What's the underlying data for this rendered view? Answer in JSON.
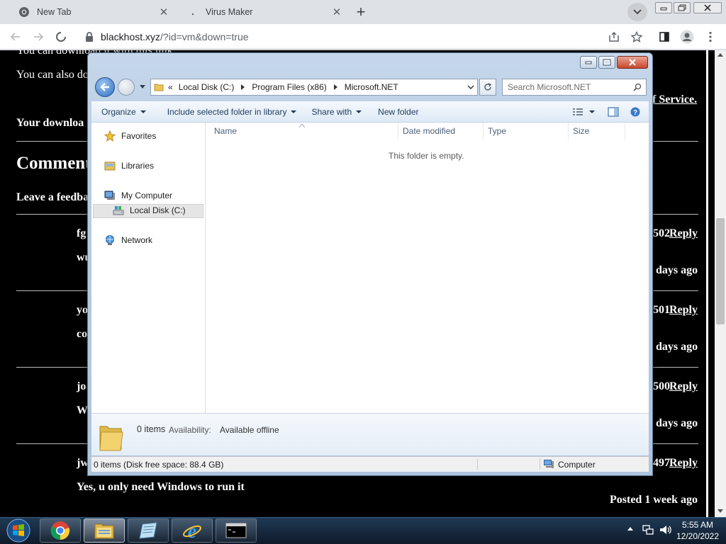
{
  "browser": {
    "tabs": [
      {
        "title": "New Tab"
      },
      {
        "title": "Virus Maker"
      }
    ],
    "url_host": "blackhost.xyz",
    "url_path": "/?id=vm&down=true"
  },
  "page": {
    "line_download": "You can download it with this link",
    "line_also": "You can also do",
    "terms_link": "f Service.",
    "your_download": "Your downloa",
    "comments_heading": "Comment",
    "leave_feedback": "Leave a feedba",
    "comments": [
      {
        "author": "fg",
        "id": "502",
        "text": "wu",
        "posted": "days ago"
      },
      {
        "author": "yo",
        "id": "501",
        "text": "co",
        "posted": "days ago"
      },
      {
        "author": "jo",
        "id": "500",
        "text": "W",
        "posted": "days ago"
      },
      {
        "author": "jw",
        "id": "497",
        "text": "Yes, u only need Windows to run it",
        "posted": "Posted 1 week ago"
      }
    ],
    "reply_label": "Reply"
  },
  "explorer": {
    "breadcrumb": [
      "Local Disk (C:)",
      "Program Files (x86)",
      "Microsoft.NET"
    ],
    "breadcrumb_prefix": "«",
    "search_placeholder": "Search Microsoft.NET",
    "commands": [
      "Organize",
      "Include selected folder in library",
      "Share with",
      "New folder"
    ],
    "nav_items": {
      "favorites": "Favorites",
      "libraries": "Libraries",
      "my_computer": "My Computer",
      "local_disk": "Local Disk (C:)",
      "network": "Network"
    },
    "columns": [
      "Name",
      "Date modified",
      "Type",
      "Size"
    ],
    "empty_message": "This folder is empty.",
    "details": {
      "items": "0 items",
      "availability_label": "Availability:",
      "availability_value": "Available offline"
    },
    "status": {
      "left": "0 items (Disk free space: 88.4 GB)",
      "right": "Computer"
    }
  },
  "taskbar": {
    "apps": [
      "chrome-icon",
      "explorer-icon",
      "notepad-icon",
      "ie-icon",
      "cmd-icon"
    ],
    "time": "5:55 AM",
    "date": "12/20/2022"
  }
}
